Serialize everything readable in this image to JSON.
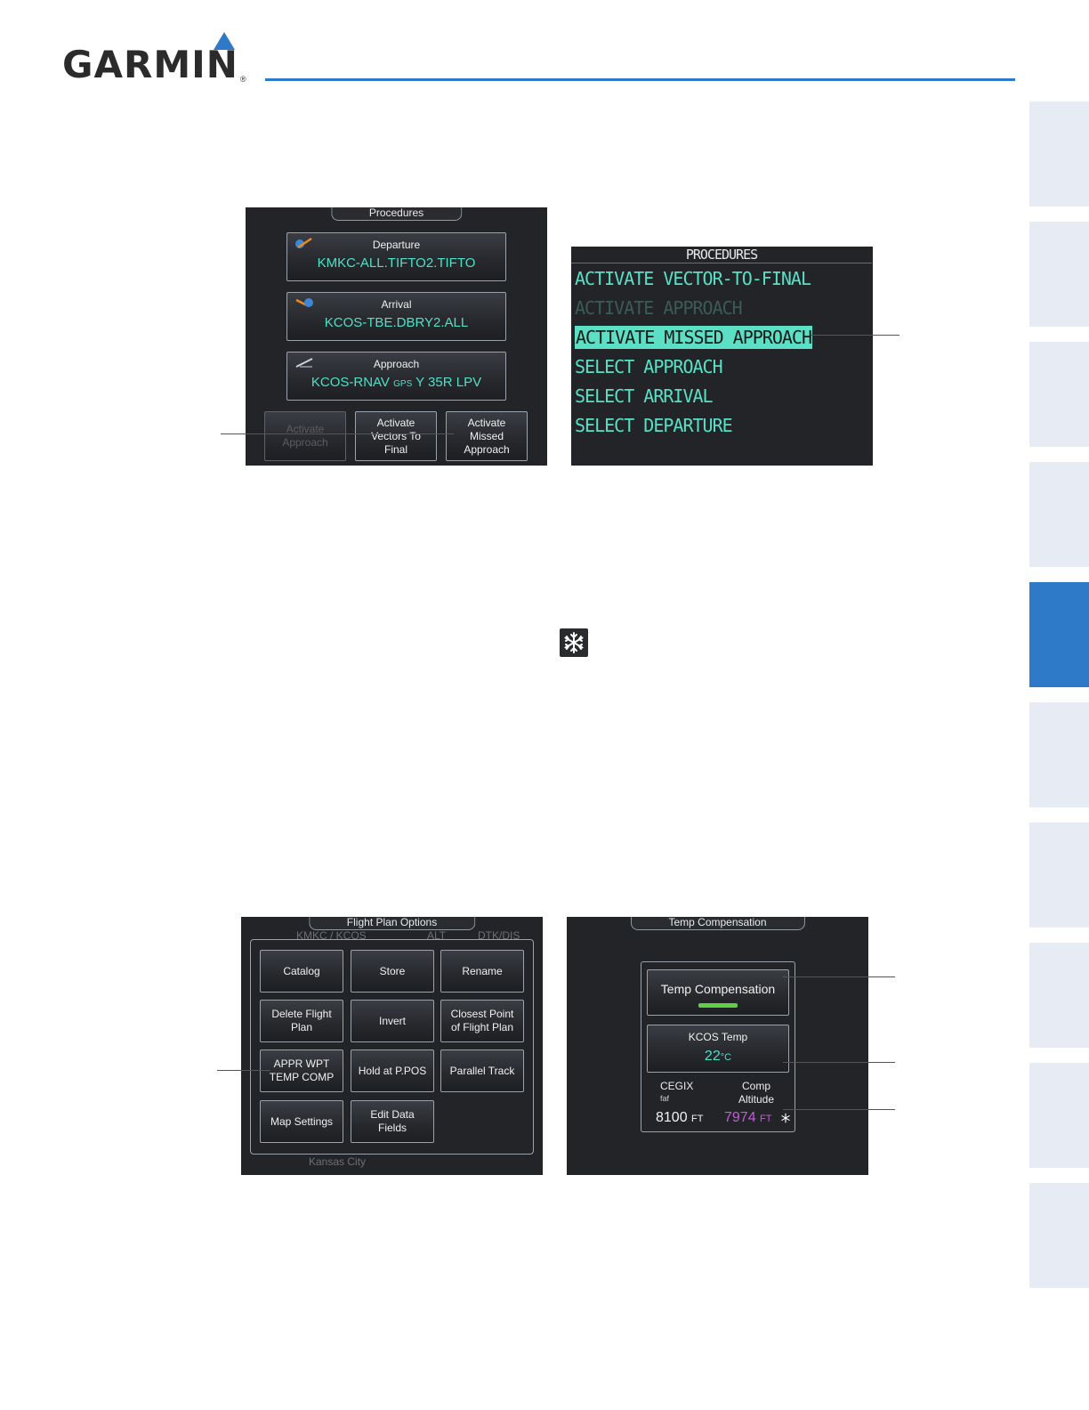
{
  "header": {
    "brand": "GARMIN",
    "reg": "®"
  },
  "procedures_touch": {
    "title": "Procedures",
    "departure": {
      "label": "Departure",
      "value": "KMKC-ALL.TIFTO2.TIFTO"
    },
    "arrival": {
      "label": "Arrival",
      "value": "KCOS-TBE.DBRY2.ALL"
    },
    "approach": {
      "label": "Approach",
      "value_pre": "KCOS-RNAV",
      "value_gps": "GPS",
      "value_post": "Y 35R LPV"
    },
    "buttons": {
      "activate_approach": [
        "Activate",
        "Approach"
      ],
      "activate_vectors": [
        "Activate",
        "Vectors To",
        "Final"
      ],
      "activate_missed": [
        "Activate",
        "Missed",
        "Approach"
      ]
    }
  },
  "procedures_list": {
    "title": "PROCEDURES",
    "items": [
      {
        "label": "ACTIVATE VECTOR-TO-FINAL",
        "state": "normal"
      },
      {
        "label": "ACTIVATE APPROACH",
        "state": "disabled"
      },
      {
        "label": "ACTIVATE MISSED APPROACH",
        "state": "selected"
      },
      {
        "label": "SELECT APPROACH",
        "state": "normal"
      },
      {
        "label": "SELECT ARRIVAL",
        "state": "normal"
      },
      {
        "label": "SELECT DEPARTURE",
        "state": "normal"
      }
    ]
  },
  "snowflake_icon": "snowflake-icon",
  "flight_plan_options": {
    "title": "Flight Plan Options",
    "ghost_route": "KMKC / KCOS",
    "ghost_alt": "ALT",
    "ghost_dtk": "DTK/DIS",
    "ghost_city": "Kansas City",
    "buttons": [
      [
        "Catalog"
      ],
      [
        "Store"
      ],
      [
        "Rename"
      ],
      [
        "Delete Flight",
        "Plan"
      ],
      [
        "Invert"
      ],
      [
        "Closest Point",
        "of Flight Plan"
      ],
      [
        "APPR WPT",
        "TEMP COMP"
      ],
      [
        "Hold at P.POS"
      ],
      [
        "Parallel Track"
      ],
      [
        "Map Settings"
      ],
      [
        "Edit Data",
        "Fields"
      ]
    ]
  },
  "temp_comp": {
    "title": "Temp Compensation",
    "toggle_label": "Temp Compensation",
    "toggle_on": true,
    "temp_label": "KCOS Temp",
    "temp_value": "22",
    "temp_unit": "°C",
    "wpt_name": "CEGIX",
    "wpt_sub": "faf",
    "wpt_alt": "8100",
    "wpt_alt_unit": "FT",
    "comp_label_1": "Comp",
    "comp_label_2": "Altitude",
    "comp_alt": "7974",
    "comp_alt_unit": "FT",
    "colors": {
      "cyan": "#4fe0c8",
      "magenta": "#c45bd8",
      "green": "#5fd046"
    }
  }
}
